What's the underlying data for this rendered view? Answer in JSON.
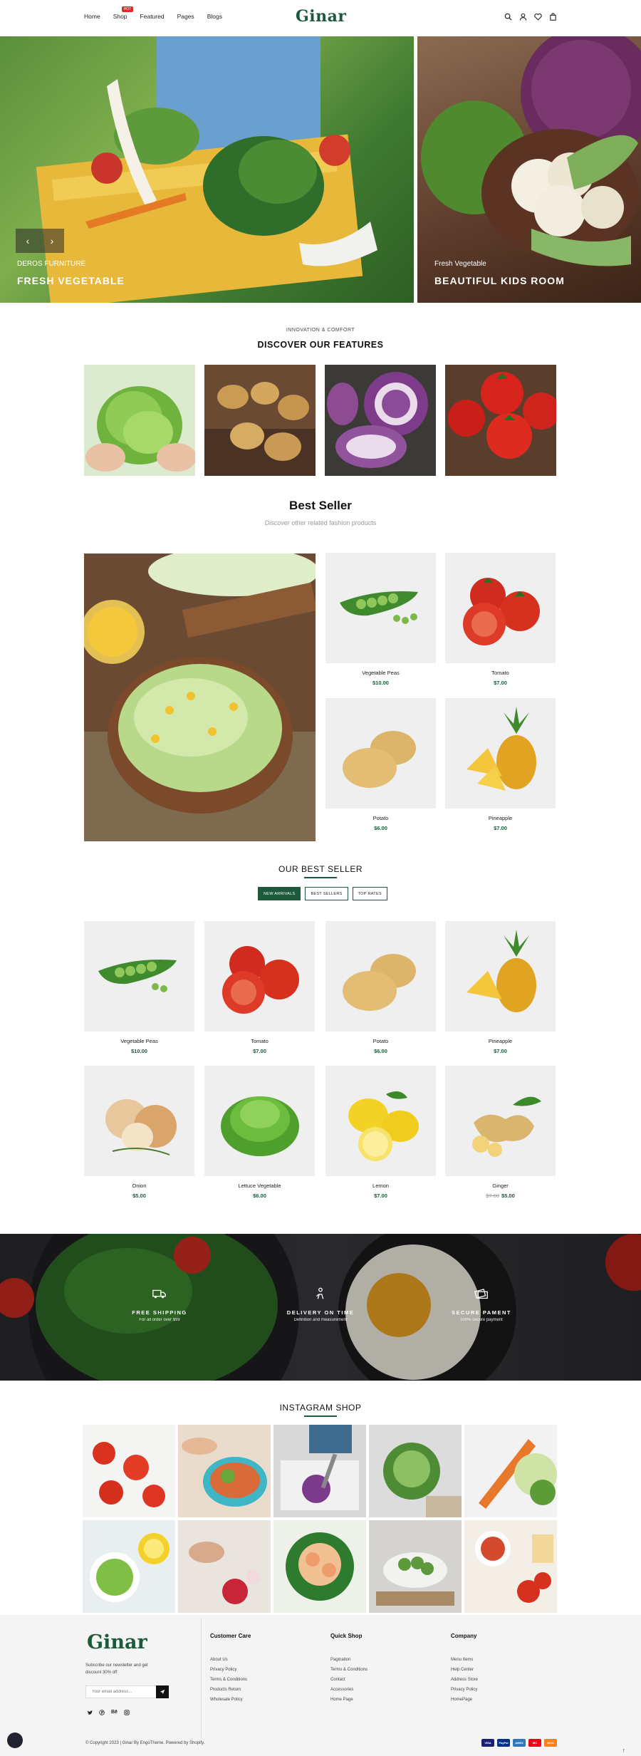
{
  "header": {
    "nav": [
      {
        "label": "Home"
      },
      {
        "label": "Shop",
        "badge": "HOT"
      },
      {
        "label": "Featured"
      },
      {
        "label": "Pages"
      },
      {
        "label": "Blogs"
      }
    ],
    "logo": "Ginar",
    "icons": [
      "search-icon",
      "user-icon",
      "heart-icon",
      "bag-icon"
    ]
  },
  "hero": {
    "left": {
      "subtitle": "DEROS FURNITURE",
      "title": "FRESH VEGETABLE"
    },
    "right": {
      "subtitle": "Fresh Vegetable",
      "title": "BEAUTIFUL KIDS ROOM"
    },
    "prev_arrow": "‹",
    "next_arrow": "›"
  },
  "features": {
    "eyebrow": "INNOVATION & COMFORT",
    "title": "DISCOVER OUR FEATURES",
    "images": [
      "lettuce",
      "potatoes",
      "red-cabbage",
      "tomatoes"
    ]
  },
  "best_seller": {
    "title": "Best Seller",
    "subtitle": "Discover other related fashion products",
    "products": [
      {
        "name": "Vegetable Peas",
        "price": "$10.00"
      },
      {
        "name": "Tomato",
        "price": "$7.00"
      },
      {
        "name": "Potato",
        "price": "$6.00"
      },
      {
        "name": "Pineapple",
        "price": "$7.00"
      }
    ]
  },
  "our_best_seller": {
    "title": "OUR BEST SELLER",
    "tabs": [
      "NEW ARRIVALS",
      "BEST SELLERS",
      "TOP RATES"
    ],
    "active_tab": "NEW ARRIVALS",
    "products": [
      {
        "name": "Vegetable Peas",
        "price": "$10.00"
      },
      {
        "name": "Tomato",
        "price": "$7.00"
      },
      {
        "name": "Potato",
        "price": "$6.00"
      },
      {
        "name": "Pineapple",
        "price": "$7.00"
      },
      {
        "name": "Onion",
        "price": "$5.00"
      },
      {
        "name": "Lettuce Vegetable",
        "price": "$6.00"
      },
      {
        "name": "Lemon",
        "price": "$7.00"
      },
      {
        "name": "Ginger",
        "old_price": "$7.00",
        "price": "$5.00"
      }
    ]
  },
  "services": [
    {
      "title": "FREE SHIPPING",
      "desc": "For all order over $99",
      "icon": "truck-icon"
    },
    {
      "title": "DELIVERY ON TIME",
      "desc": "Definition and measurement",
      "icon": "delivery-icon"
    },
    {
      "title": "SECURE PAMENT",
      "desc": "100% secure payment",
      "icon": "secure-payment-icon"
    }
  ],
  "instagram": {
    "title": "INSTAGRAM SHOP"
  },
  "footer": {
    "logo": "Ginar",
    "newsletter_text": "Subscribe our newsletter and get discount 30% off",
    "email_placeholder": "Your email address...",
    "social": [
      "twitter-icon",
      "pinterest-icon",
      "behance-icon",
      "instagram-icon"
    ],
    "columns": [
      {
        "title": "Customer Care",
        "links": [
          "About Us",
          "Privacy Policy",
          "Terms & Conditions",
          "Products Return",
          "Wholesale Policy"
        ]
      },
      {
        "title": "Quick Shop",
        "links": [
          "Pagination",
          "Terms & Conditions",
          "Contact",
          "Accessories",
          "Home Page"
        ]
      },
      {
        "title": "Company",
        "links": [
          "Menu Items",
          "Help Center",
          "Address Store",
          "Privacy Policy",
          "HomePage"
        ]
      }
    ],
    "copyright": "© Copyright 2023 | Ginar By EngoTheme. Powered by Shopify.",
    "payments": [
      "VISA",
      "PayPal",
      "AMEX",
      "MC",
      "DISC"
    ],
    "scroll_top": "↑"
  }
}
